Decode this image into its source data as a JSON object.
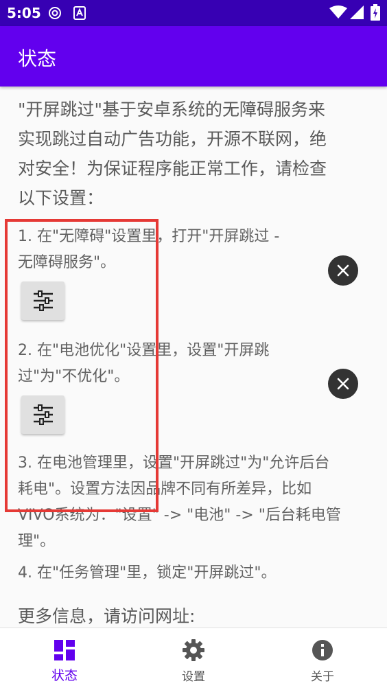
{
  "status_bar": {
    "time": "5:05",
    "icons": [
      "vpn-key-icon",
      "app-notification-icon",
      "wifi-icon",
      "signal-icon",
      "battery-icon"
    ]
  },
  "app_bar": {
    "title": "状态"
  },
  "intro": {
    "lines": [
      "\"开屏跳过\"基于安卓系统的无障碍服务来",
      "实现跳过自动广告功能，开源不联网，绝",
      "对安全！为保证程序能正常工作，请检查",
      "以下设置："
    ]
  },
  "steps": [
    {
      "lines": [
        "1. 在\"无障碍\"设置里，打开\"开屏跳过 -",
        "无障碍服务\"。"
      ]
    },
    {
      "lines": [
        "2. 在\"电池优化\"设置里，设置\"开屏跳",
        "过\"为\"不优化\"。"
      ]
    },
    {
      "lines": [
        "3. 在电池管理里，设置\"开屏跳过\"为\"允许后台",
        "耗电\"。设置方法因品牌不同有所差异，比如",
        "VIVO系统为：\"设置\" -> \"电池\" -> \"后台耗电管",
        "理\"。"
      ]
    },
    {
      "lines": [
        "4. 在\"任务管理\"里，锁定\"开屏跳过\"。"
      ]
    }
  ],
  "more_info": "更多信息，请访问网址:",
  "bottom_nav": {
    "items": [
      {
        "label": "状态",
        "icon": "dashboard-icon",
        "active": true
      },
      {
        "label": "设置",
        "icon": "gear-icon",
        "active": false
      },
      {
        "label": "关于",
        "icon": "info-icon",
        "active": false
      }
    ]
  },
  "colors": {
    "status_bar": "#3700b3",
    "app_bar": "#6200ee",
    "accent": "#6200ee",
    "highlight": "#e53935"
  }
}
